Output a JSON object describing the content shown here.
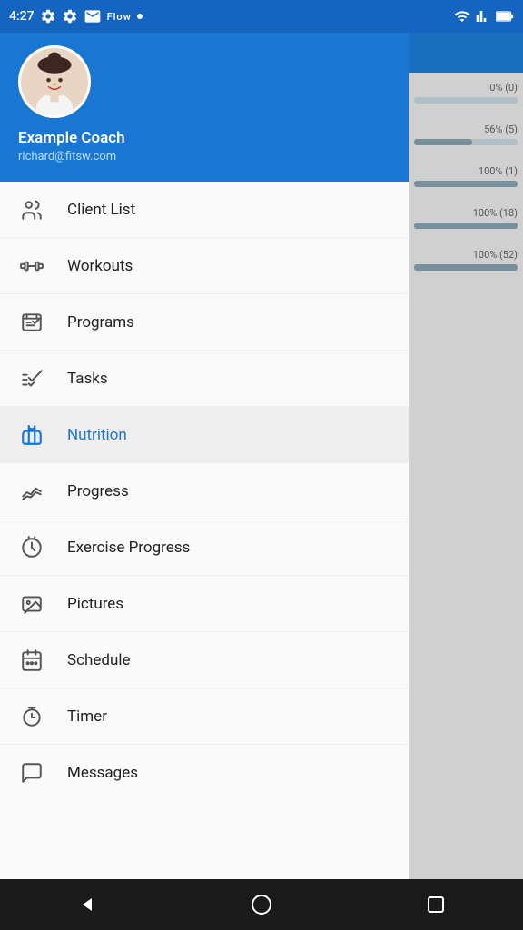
{
  "statusBar": {
    "time": "4:27",
    "rightIcons": [
      "wifi",
      "signal",
      "battery"
    ]
  },
  "drawerHeader": {
    "coachName": "Example Coach",
    "coachEmail": "richard@fitsw.com"
  },
  "menuItems": [
    {
      "id": "client-list",
      "label": "Client List",
      "icon": "clients",
      "active": false
    },
    {
      "id": "workouts",
      "label": "Workouts",
      "icon": "dumbbell",
      "active": false
    },
    {
      "id": "programs",
      "label": "Programs",
      "icon": "programs",
      "active": false
    },
    {
      "id": "tasks",
      "label": "Tasks",
      "icon": "tasks",
      "active": false
    },
    {
      "id": "nutrition",
      "label": "Nutrition",
      "icon": "nutrition",
      "active": true
    },
    {
      "id": "progress",
      "label": "Progress",
      "icon": "progress",
      "active": false
    },
    {
      "id": "exercise-progress",
      "label": "Exercise Progress",
      "icon": "exercise-progress",
      "active": false
    },
    {
      "id": "pictures",
      "label": "Pictures",
      "icon": "pictures",
      "active": false
    },
    {
      "id": "schedule",
      "label": "Schedule",
      "icon": "schedule",
      "active": false
    },
    {
      "id": "timer",
      "label": "Timer",
      "icon": "timer",
      "active": false
    },
    {
      "id": "messages",
      "label": "Messages",
      "icon": "messages",
      "active": false
    }
  ],
  "rightPanel": [
    {
      "text": "0% (0)",
      "barWidth": "0%"
    },
    {
      "text": "56% (5)",
      "barWidth": "56%"
    },
    {
      "text": "100% (1)",
      "barWidth": "100%"
    },
    {
      "text": "100% (18)",
      "barWidth": "100%"
    },
    {
      "text": "100% (52)",
      "barWidth": "100%"
    }
  ]
}
